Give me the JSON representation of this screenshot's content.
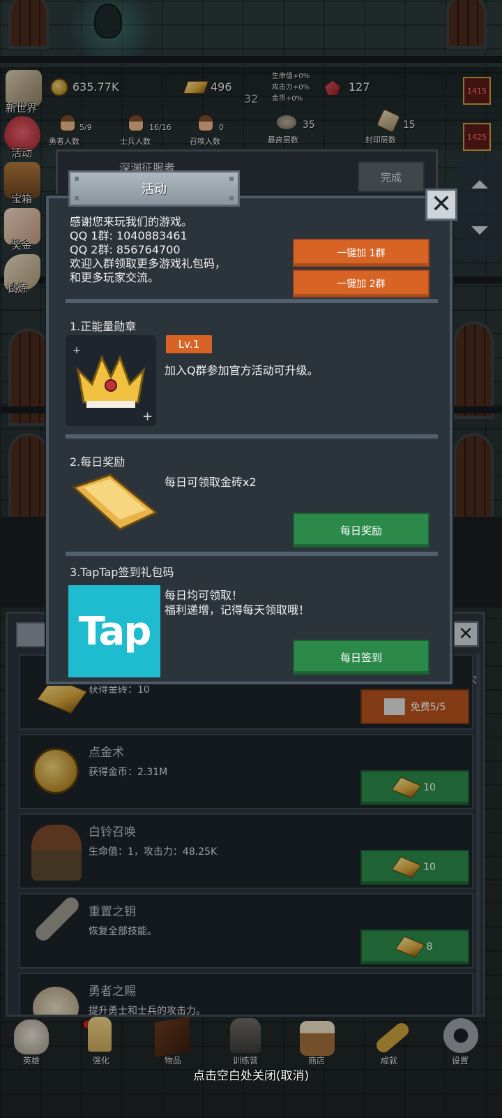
{
  "hud": {
    "gold": "635.77K",
    "gold_bricks": "496",
    "bonus_lines": [
      "生命值+0%",
      "攻击力+0%",
      "金币+0%"
    ],
    "sub_value": "32",
    "gems": "127",
    "stats": [
      {
        "value": "5/9",
        "label": "勇者人数"
      },
      {
        "value": "16/16",
        "label": "士兵人数"
      },
      {
        "value": "0",
        "label": "召唤人数"
      },
      {
        "value": "35",
        "label": "最高层数"
      },
      {
        "value": "15",
        "label": "封印层数"
      }
    ],
    "floor_badges": [
      "1415",
      "1425"
    ]
  },
  "side_menu": [
    "新世界",
    "活动",
    "宝箱",
    "奖金",
    "试炼"
  ],
  "behind_panel": {
    "title": "深渊征服者",
    "done_label": "完成"
  },
  "shop": {
    "count_suffix": "5次",
    "rows": [
      {
        "title": "",
        "desc": "获得金砖：10",
        "btn": "免费5/5",
        "icon": "gold-bar-icon"
      },
      {
        "title": "点金术",
        "desc": "获得金币：2.31M",
        "btn": "10",
        "icon": "gold-coin-icon"
      },
      {
        "title": "白铃召唤",
        "desc": "生命值：1，攻击力：48.25K",
        "btn": "10",
        "icon": "summon-hero-icon"
      },
      {
        "title": "重置之钥",
        "desc": "恢复全部技能。",
        "btn": "8",
        "icon": "key-icon"
      },
      {
        "title": "勇者之赐",
        "desc": "提升勇士和士兵的攻击力。",
        "btn": "",
        "icon": "gift-icon"
      }
    ]
  },
  "modal": {
    "title": "活动",
    "intro": "感谢您来玩我们的游戏。\nQQ 1群: 1040883461\nQQ 2群: 856764700\n欢迎入群领取更多游戏礼包码，\n和更多玩家交流。",
    "join_group1": "一键加 1群",
    "join_group2": "一键加 2群",
    "sections": [
      {
        "title": "1.正能量勋章",
        "badge": "Lv.1",
        "body": "加入Q群参加官方活动可升级。"
      },
      {
        "title": "2.每日奖励",
        "body": "每日可领取金砖x2",
        "button": "每日奖励"
      },
      {
        "title": "3.TapTap签到礼包码",
        "body": "每日均可领取！\n福利递增，记得每天领取哦！",
        "button": "每日签到",
        "logo_text": "Tap"
      }
    ]
  },
  "bottom_nav": [
    "英雄",
    "强化",
    "物品",
    "训练营",
    "商店",
    "成就",
    "设置"
  ],
  "close_hint": "点击空白处关闭(取消)",
  "colors": {
    "accent_orange": "#d76425",
    "accent_green": "#2b8a4a",
    "tap_blue": "#1fbcd0"
  }
}
